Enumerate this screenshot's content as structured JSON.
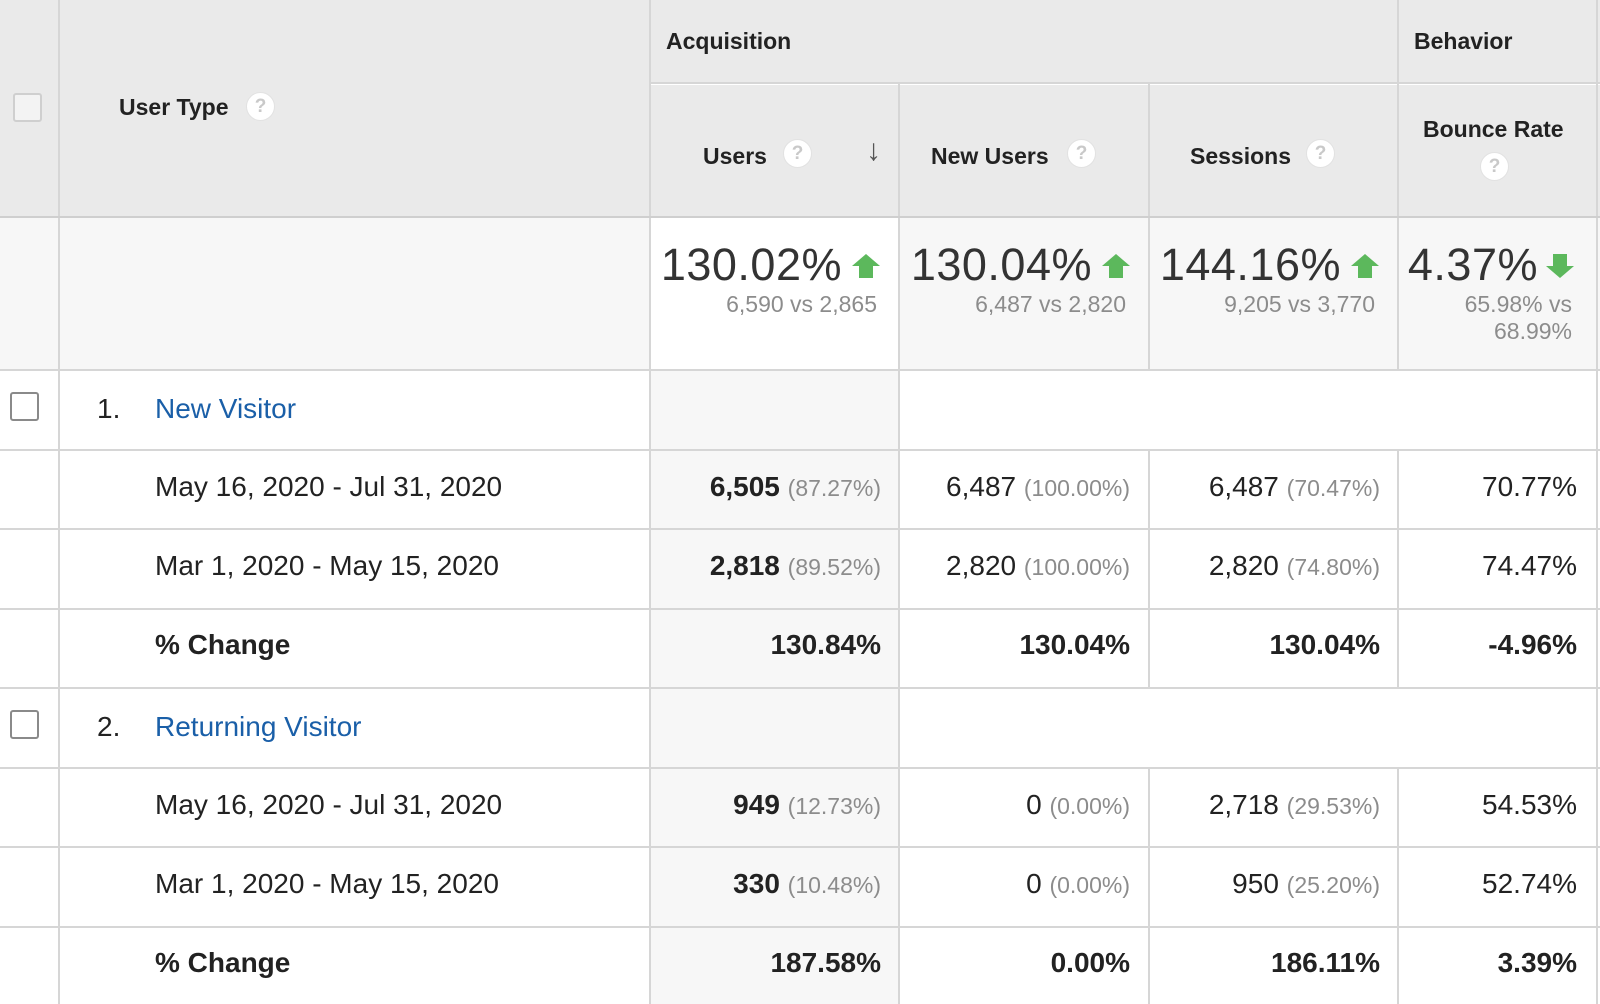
{
  "header": {
    "dimension_label": "User Type",
    "group_acquisition": "Acquisition",
    "group_behavior": "Behavior",
    "col_users": "Users",
    "col_new_users": "New Users",
    "col_sessions": "Sessions",
    "col_bounce_rate": "Bounce Rate",
    "help_glyph": "?",
    "sort_glyph": "↓"
  },
  "totals": {
    "users": {
      "change": "130.02%",
      "detail": "6,590 vs 2,865",
      "direction": "up"
    },
    "new_users": {
      "change": "130.04%",
      "detail": "6,487 vs 2,820",
      "direction": "up"
    },
    "sessions": {
      "change": "144.16%",
      "detail": "9,205 vs 3,770",
      "direction": "up"
    },
    "bounce_rate": {
      "change": "4.37%",
      "detail_line1": "65.98% vs",
      "detail_line2": "68.99%",
      "direction": "down"
    }
  },
  "colors": {
    "up": "#5cb85c",
    "down": "#5cb85c",
    "link": "#1a5fa8"
  },
  "groups": [
    {
      "num": "1.",
      "name": "New Visitor",
      "rows": [
        {
          "label": "May 16, 2020 - Jul 31, 2020",
          "users": "6,505",
          "users_pct": "(87.27%)",
          "new_users": "6,487",
          "new_users_pct": "(100.00%)",
          "sessions": "6,487",
          "sessions_pct": "(70.47%)",
          "bounce": "70.77%"
        },
        {
          "label": "Mar 1, 2020 - May 15, 2020",
          "users": "2,818",
          "users_pct": "(89.52%)",
          "new_users": "2,820",
          "new_users_pct": "(100.00%)",
          "sessions": "2,820",
          "sessions_pct": "(74.80%)",
          "bounce": "74.47%"
        }
      ],
      "change": {
        "label": "% Change",
        "users": "130.84%",
        "new_users": "130.04%",
        "sessions": "130.04%",
        "bounce": "-4.96%"
      }
    },
    {
      "num": "2.",
      "name": "Returning Visitor",
      "rows": [
        {
          "label": "May 16, 2020 - Jul 31, 2020",
          "users": "949",
          "users_pct": "(12.73%)",
          "new_users": "0",
          "new_users_pct": "(0.00%)",
          "sessions": "2,718",
          "sessions_pct": "(29.53%)",
          "bounce": "54.53%"
        },
        {
          "label": "Mar 1, 2020 - May 15, 2020",
          "users": "330",
          "users_pct": "(10.48%)",
          "new_users": "0",
          "new_users_pct": "(0.00%)",
          "sessions": "950",
          "sessions_pct": "(25.20%)",
          "bounce": "52.74%"
        }
      ],
      "change": {
        "label": "% Change",
        "users": "187.58%",
        "new_users": "0.00%",
        "sessions": "186.11%",
        "bounce": "3.39%"
      }
    }
  ]
}
